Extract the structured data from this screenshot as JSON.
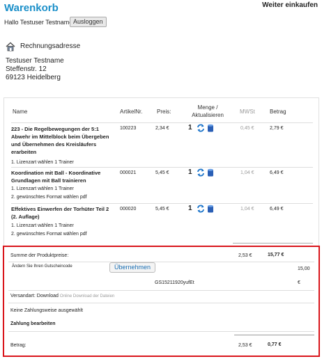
{
  "header": {
    "title": "Warenkorb",
    "continue_shopping": "Weiter einkaufen",
    "greeting": "Hallo Testuser Testname",
    "logout_label": "Ausloggen"
  },
  "billing": {
    "title": "Rechnungsadresse",
    "address": [
      "Testuser Testname",
      "Steffenstr. 12",
      "69123 Heidelberg"
    ]
  },
  "cart": {
    "columns": {
      "name": "Name",
      "article_no": "ArtikelNr.",
      "price": "Preis:",
      "quantity": "Menge /\nAktualisieren",
      "vat": "MWSt",
      "amount": "Betrag"
    },
    "items": [
      {
        "name": "223 - Die Regelbewegungen der 5:1 Abwehr im Mittelblock beim Übergeben und Übernehmen des Kreisläufers erarbeiten",
        "options": [
          "1. Lizenzart wählen 1 Trainer"
        ],
        "article_no": "100223",
        "price": "2,34 €",
        "quantity": "1",
        "vat": "0,45 €",
        "amount": "2,79 €"
      },
      {
        "name": "Koordination mit Ball - Koordinative Grundlagen mit Ball trainieren",
        "options": [
          "1. Lizenzart wählen 1 Trainer",
          "2. gewünschtes Format wählen pdf"
        ],
        "article_no": "000021",
        "price": "5,45 €",
        "quantity": "1",
        "vat": "1,04 €",
        "amount": "6,49 €"
      },
      {
        "name": "Effektives Einwerfen der Torhüter Teil 2 (2. Auflage)",
        "options": [
          "1. Lizenzart wählen 1 Trainer",
          "2. gewünschtes Format wählen pdf"
        ],
        "article_no": "000020",
        "price": "5,45 €",
        "quantity": "1",
        "vat": "1,04 €",
        "amount": "6,49 €"
      }
    ]
  },
  "summary": {
    "product_total_label": "Summe der Produktpreise:",
    "product_total_vat": "2,53 €",
    "product_total": "15,77 €",
    "voucher_placeholder": "Ändern Sie Ihren Gutscheincode",
    "apply_label": "Übernehmen",
    "voucher_code": "GS15211920yufEt",
    "voucher_amount": "15,00",
    "voucher_currency": "€",
    "shipping_label": "Versandart:",
    "shipping_method": "Download",
    "shipping_desc": "Online Download der Dateien",
    "payment_note": "Keine Zahlungsweise ausgewählt",
    "payment_edit": "Zahlung bearbeiten",
    "total_label": "Betrag:",
    "total_vat": "2,53 €",
    "total": "0,77 €"
  },
  "colors": {
    "title": "#1a8fc9",
    "highlight_border": "#d9141a",
    "icon_blue": "#1a73c9"
  }
}
